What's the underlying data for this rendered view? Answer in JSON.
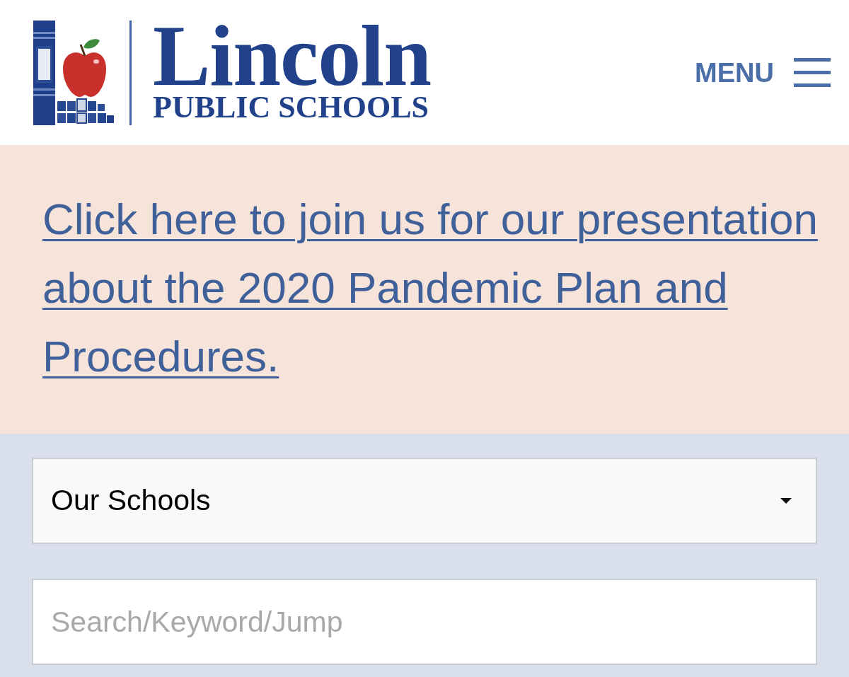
{
  "header": {
    "logo": {
      "name": "Lincoln",
      "subtitle": "PUBLIC SCHOOLS"
    },
    "menu": {
      "label": "MENU"
    }
  },
  "announcement": {
    "link": "Click here to join us for our presentation about the 2020 Pandemic Plan and Procedures."
  },
  "school_select": {
    "value": "Our Schools"
  },
  "search": {
    "placeholder": "Search/Keyword/Jump"
  }
}
